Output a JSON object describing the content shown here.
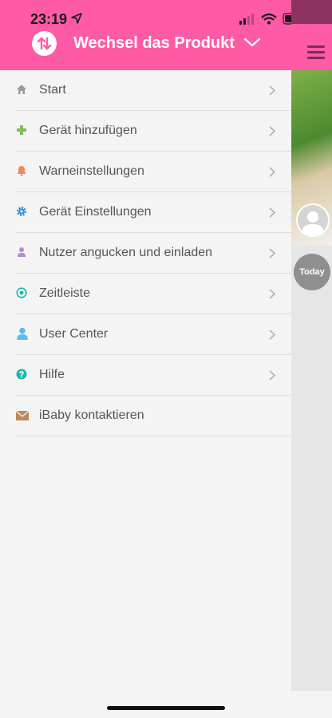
{
  "status": {
    "time": "23:19"
  },
  "header": {
    "title": "Wechsel das Produkt"
  },
  "menu": {
    "items": [
      {
        "label": "Start",
        "icon": "home-icon",
        "color": "#9a9a9a"
      },
      {
        "label": "Gerät hinzufügen",
        "icon": "plus-icon",
        "color": "#7fbf59"
      },
      {
        "label": "Warneinstellungen",
        "icon": "bell-icon",
        "color": "#f08a5a"
      },
      {
        "label": "Gerät Einstellungen",
        "icon": "gear-icon",
        "color": "#2f8fd0"
      },
      {
        "label": "Nutzer angucken und einladen",
        "icon": "user-icon",
        "color": "#b48ad6"
      },
      {
        "label": "Zeitleiste",
        "icon": "timeline-icon",
        "color": "#1bb8b0"
      },
      {
        "label": "User Center",
        "icon": "person-icon",
        "color": "#63b8e6"
      },
      {
        "label": "Hilfe",
        "icon": "help-icon",
        "color": "#1bb8b0"
      },
      {
        "label": "iBaby kontaktieren",
        "icon": "mail-icon",
        "color": "#b98a5a"
      }
    ]
  },
  "peek": {
    "today_label": "Today"
  },
  "colors": {
    "brand": "#ff5aa5"
  }
}
